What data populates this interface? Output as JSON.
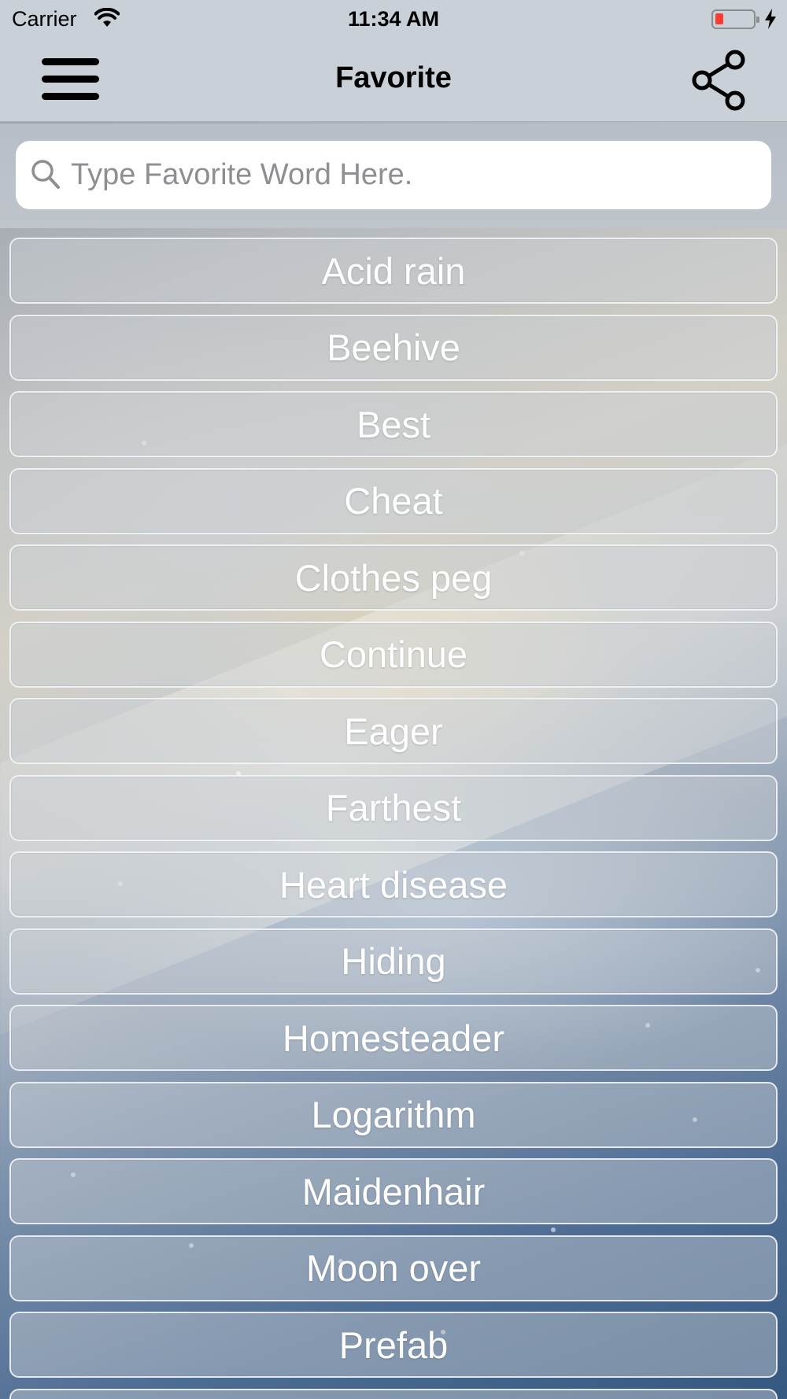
{
  "status_bar": {
    "carrier": "Carrier",
    "time": "11:34 AM",
    "battery_color": "#ff3b30"
  },
  "nav": {
    "title": "Favorite",
    "menu_icon": "hamburger-menu-icon",
    "share_icon": "share-icon"
  },
  "search": {
    "placeholder": "Type Favorite Word Here.",
    "value": "",
    "icon": "search-icon"
  },
  "favorites": [
    "Acid rain",
    "Beehive",
    "Best",
    "Cheat",
    "Clothes peg",
    "Continue",
    "Eager",
    "Farthest",
    "Heart disease",
    "Hiding",
    "Homesteader",
    "Logarithm",
    "Maidenhair",
    "Moon over",
    "Prefab"
  ]
}
